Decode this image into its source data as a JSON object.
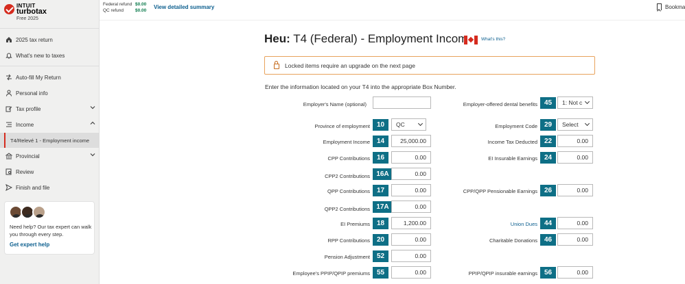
{
  "brand": {
    "line1": "INTUIT",
    "line2": "turbotax",
    "edition": "Free 2025"
  },
  "topbar": {
    "federal_label": "Federal refund",
    "federal_value": "$0.00",
    "qc_label": "QC refund",
    "qc_value": "$0.00",
    "summary_link": "View detailed summary",
    "bookmark_label": "Bookmar"
  },
  "sidebar": {
    "items": [
      {
        "label": "2025 tax return",
        "icon": "home-icon"
      },
      {
        "label": "What's new to taxes",
        "icon": "bell-icon"
      },
      {
        "label": "Auto-fill My Return",
        "icon": "autofill-icon"
      },
      {
        "label": "Personal info",
        "icon": "person-icon"
      },
      {
        "label": "Tax profile",
        "icon": "edit-icon"
      },
      {
        "label": "Income",
        "icon": "income-icon"
      },
      {
        "label": "T4/Relevé 1 - Employment income",
        "icon": ""
      },
      {
        "label": "Provincial",
        "icon": "bank-icon"
      },
      {
        "label": "Review",
        "icon": "review-icon"
      },
      {
        "label": "Finish and file",
        "icon": "send-icon"
      }
    ],
    "help": {
      "text": "Need help? Our tax expert can walk you through every step.",
      "link": "Get expert help"
    }
  },
  "main": {
    "title_bold": "Heu:",
    "title_rest": " T4 (Federal) - Employment Income",
    "whats_this": "What's this?",
    "alert": "Locked items require an upgrade on the next page",
    "intro": "Enter the information located on your T4 into the appropriate Box Number."
  },
  "form": {
    "employer_name_label": "Employer's Name (optional)",
    "employer_name_value": "",
    "dental_label": "Employer-offered dental benefits",
    "dental_box": "45",
    "dental_value": "1: Not c",
    "province_label": "Province of employment",
    "province_box": "10",
    "province_value": "QC",
    "emp_code_label": "Employment Code",
    "emp_code_box": "29",
    "emp_code_value": "Select",
    "left": [
      {
        "label": "Employment Income",
        "box": "14",
        "value": "25,000.00"
      },
      {
        "label": "CPP Contributions",
        "box": "16",
        "value": "0.00"
      },
      {
        "label": "CPP2 Contributions",
        "box": "16A",
        "value": "0.00"
      },
      {
        "label": "QPP Contributions",
        "box": "17",
        "value": "0.00"
      },
      {
        "label": "QPP2 Contributions",
        "box": "17A",
        "value": "0.00"
      },
      {
        "label": "EI Premiums",
        "box": "18",
        "value": "1,200.00"
      },
      {
        "label": "RPP Contributions",
        "box": "20",
        "value": "0.00"
      },
      {
        "label": "Pension Adjustment",
        "box": "52",
        "value": "0.00"
      },
      {
        "label": "Employee's PPIP/QPIP premiums",
        "box": "55",
        "value": "0.00"
      }
    ],
    "right": [
      {
        "label": "Income Tax Deducted",
        "box": "22",
        "value": "0.00"
      },
      {
        "label": "EI Insurable Earnings",
        "box": "24",
        "value": "0.00"
      },
      {
        "label": "CPP/QPP Pensionable Earnings",
        "box": "26",
        "value": "0.00"
      },
      {
        "label": "Union Dues",
        "box": "44",
        "value": "0.00"
      },
      {
        "label": "Charitable Donations",
        "box": "46",
        "value": "0.00"
      },
      {
        "label": "PPIP/QPIP insurable earnings",
        "box": "56",
        "value": "0.00"
      }
    ]
  },
  "colors": {
    "box_teal": "#0e6f86",
    "accent_red": "#d52b1e",
    "link_blue": "#0b5e8e",
    "alert_orange": "#e8a25b"
  }
}
